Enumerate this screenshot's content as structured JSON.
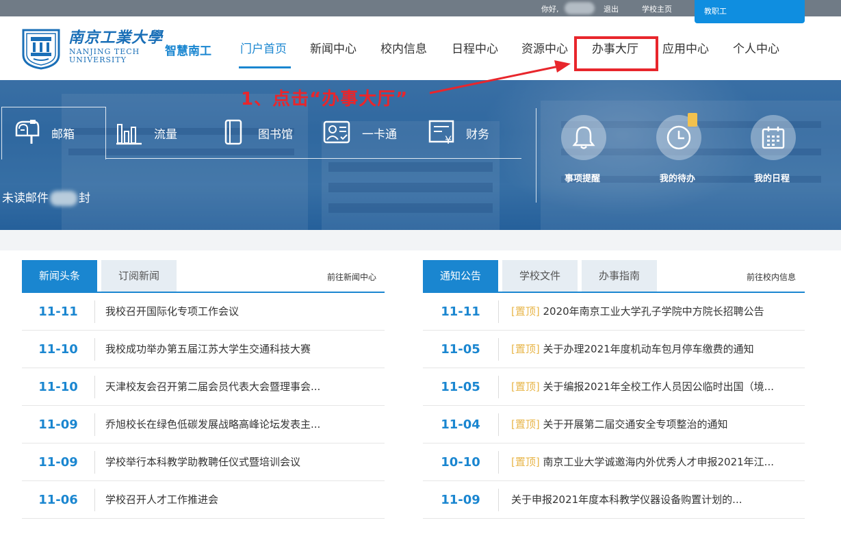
{
  "topbar": {
    "greeting": "你好,",
    "logout": "退出",
    "school_home": "学校主页",
    "role_tab": "教职工"
  },
  "header": {
    "logo_cn": "南京工業大學",
    "logo_en_line1": "NANJING TECH",
    "logo_en_line2": "UNIVERSITY",
    "brand": "智慧南工"
  },
  "nav": {
    "items": [
      {
        "label": "门户首页",
        "active": true
      },
      {
        "label": "新闻中心"
      },
      {
        "label": "校内信息"
      },
      {
        "label": "日程中心"
      },
      {
        "label": "资源中心"
      },
      {
        "label": "办事大厅",
        "highlighted": true
      },
      {
        "label": "应用中心"
      },
      {
        "label": "个人中心"
      }
    ]
  },
  "annotation": {
    "text": "1、点击“办事大厅”",
    "color": "#e8262c"
  },
  "quick": {
    "items": [
      {
        "label": "邮箱",
        "icon": "mailbox-icon"
      },
      {
        "label": "流量",
        "icon": "bar-chart-icon"
      },
      {
        "label": "图书馆",
        "icon": "book-icon"
      },
      {
        "label": "一卡通",
        "icon": "id-card-icon"
      },
      {
        "label": "财务",
        "icon": "finance-icon"
      }
    ],
    "unread_prefix": "未读邮件",
    "unread_suffix": "封"
  },
  "shortcuts": [
    {
      "label": "事项提醒",
      "icon": "bell-icon"
    },
    {
      "label": "我的待办",
      "icon": "clock-icon"
    },
    {
      "label": "我的日程",
      "icon": "calendar-icon"
    }
  ],
  "news_panel": {
    "tabs": [
      "新闻头条",
      "订阅新闻"
    ],
    "more": "前往新闻中心",
    "rows": [
      {
        "date": "11-11",
        "title": "我校召开国际化专项工作会议"
      },
      {
        "date": "11-10",
        "title": "我校成功举办第五届江苏大学生交通科技大赛"
      },
      {
        "date": "11-10",
        "title": "天津校友会召开第二届会员代表大会暨理事会..."
      },
      {
        "date": "11-09",
        "title": "乔旭校长在绿色低碳发展战略高峰论坛发表主..."
      },
      {
        "date": "11-09",
        "title": "学校举行本科教学助教聘任仪式暨培训会议"
      },
      {
        "date": "11-06",
        "title": "学校召开人才工作推进会"
      }
    ]
  },
  "notice_panel": {
    "tabs": [
      "通知公告",
      "学校文件",
      "办事指南"
    ],
    "more": "前往校内信息",
    "pin_label": "[置顶]",
    "rows": [
      {
        "date": "11-11",
        "pinned": true,
        "title": "2020年南京工业大学孔子学院中方院长招聘公告"
      },
      {
        "date": "11-05",
        "pinned": true,
        "title": "关于办理2021年度机动车包月停车缴费的通知"
      },
      {
        "date": "11-05",
        "pinned": true,
        "title": "关于编报2021年全校工作人员因公临时出国（境..."
      },
      {
        "date": "11-04",
        "pinned": true,
        "title": "关于开展第二届交通安全专项整治的通知"
      },
      {
        "date": "10-10",
        "pinned": true,
        "title": "南京工业大学诚邀海内外优秀人才申报2021年江..."
      },
      {
        "date": "11-09",
        "pinned": false,
        "title": "关于申报2021年度本科教学仪器设备购置计划的..."
      }
    ]
  },
  "colors": {
    "primary": "#1a86d0",
    "highlight": "#e8262c",
    "pin": "#e8b64a"
  }
}
